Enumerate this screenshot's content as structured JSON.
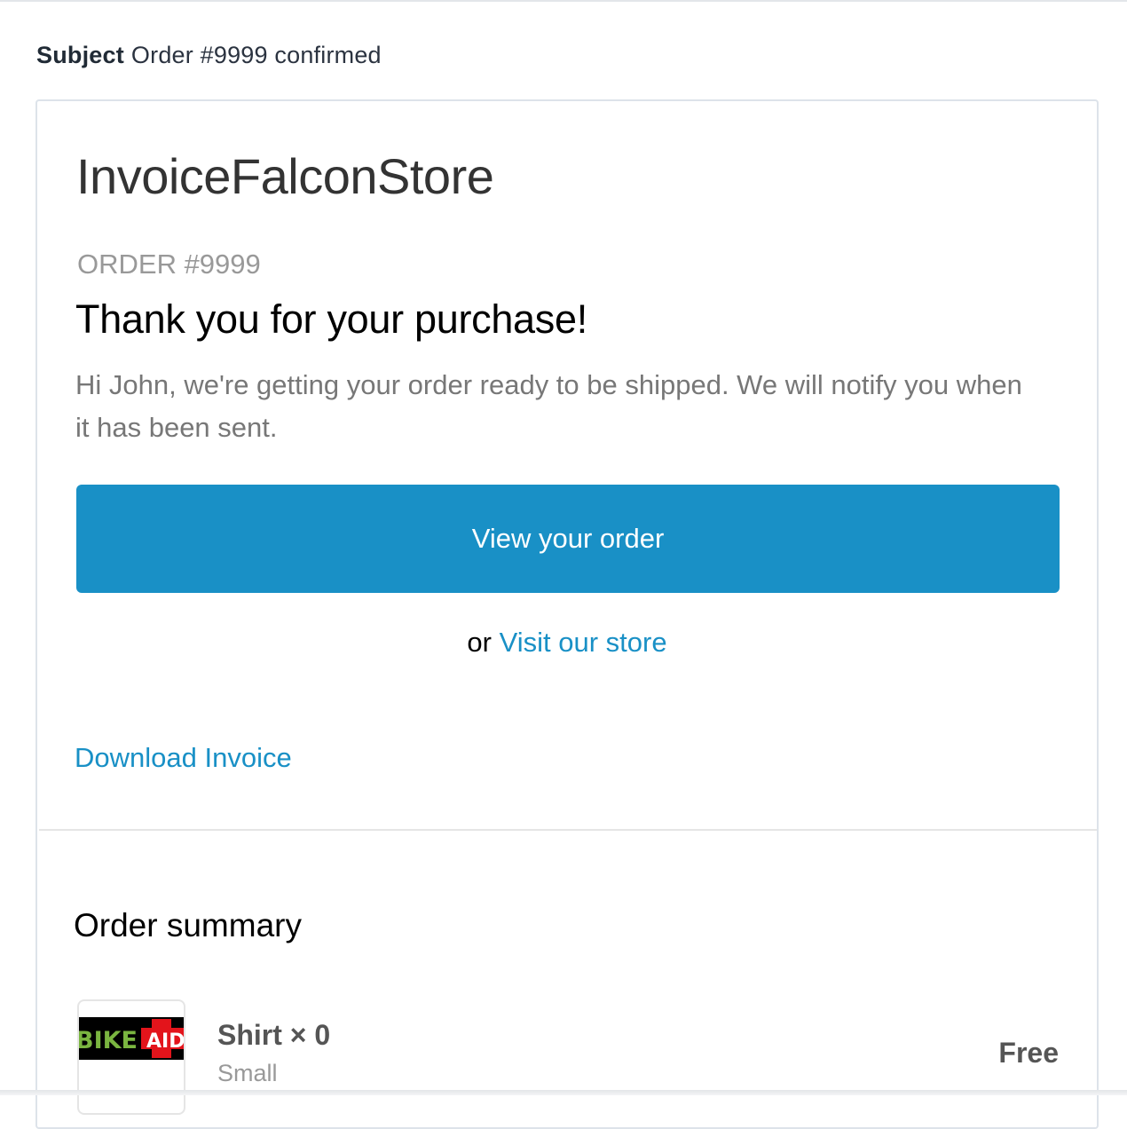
{
  "subject": {
    "label": "Subject",
    "value": "Order #9999 confirmed"
  },
  "email": {
    "shop_name": "InvoiceFalconStore",
    "order_number": "ORDER #9999",
    "heading": "Thank you for your purchase!",
    "intro": "Hi John, we're getting your order ready to be shipped. We will notify you when it has been sent.",
    "view_order_label": "View your order",
    "or_text": "or",
    "visit_store_label": "Visit our store",
    "download_invoice_label": "Download Invoice",
    "accent_color": "#1990c6"
  },
  "order_summary": {
    "heading": "Order summary",
    "items": [
      {
        "title": "Shirt × 0",
        "variant": "Small",
        "price": "Free",
        "image_logo_text": [
          "BIKE",
          "AID"
        ]
      }
    ]
  }
}
